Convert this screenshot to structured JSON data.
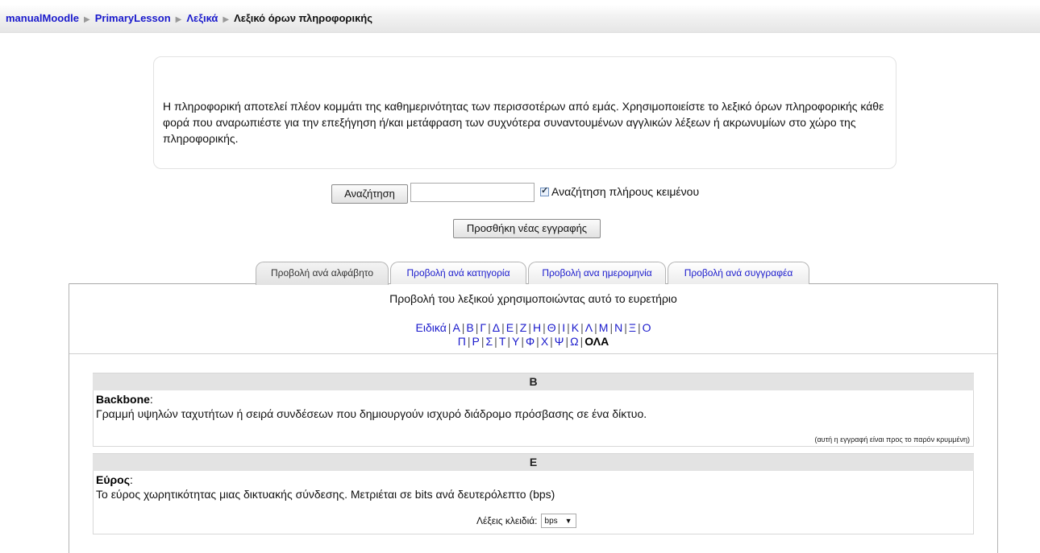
{
  "breadcrumb": {
    "items": [
      "manualMoodle",
      "PrimaryLesson",
      "Λεξικά"
    ],
    "current": "Λεξικό όρων πληροφορικής"
  },
  "intro": {
    "text": "Η πληροφορική αποτελεί πλέον κομμάτι της καθημερινότητας των περισσοτέρων από εμάς. Χρησιμοποιείστε το λεξικό όρων πληροφορικής κάθε φορά που αναρωπιέστε για την επεξήγηση ή/και μετάφραση των συχνότερα συναντουμένων αγγλικών λέξεων ή ακρωνυμίων στο χώρο της πληροφορικής."
  },
  "search": {
    "button_label": "Αναζήτηση",
    "input_value": "",
    "fulltext_checked": true,
    "fulltext_label": "Αναζήτηση πλήρους κειμένου"
  },
  "add_entry_label": "Προσθήκη νέας εγγραφής",
  "tabs": [
    {
      "label": "Προβολή ανά αλφάβητο",
      "active": true
    },
    {
      "label": "Προβολή ανά κατηγορία",
      "active": false
    },
    {
      "label": "Προβολή ανα ημερομηνία",
      "active": false
    },
    {
      "label": "Προβολή ανά συγγραφέα",
      "active": false
    }
  ],
  "index": {
    "title": "Προβολή του λεξικού χρησιμοποιώντας αυτό το ευρετήριο",
    "row1": [
      "Ειδικά",
      "Α",
      "Β",
      "Γ",
      "Δ",
      "Ε",
      "Ζ",
      "Η",
      "Θ",
      "Ι",
      "Κ",
      "Λ",
      "Μ",
      "Ν",
      "Ξ",
      "Ο"
    ],
    "row2": [
      "Π",
      "Ρ",
      "Σ",
      "Τ",
      "Υ",
      "Φ",
      "Χ",
      "Ψ",
      "Ω"
    ],
    "all_label": "ΟΛΑ"
  },
  "entries": [
    {
      "letter": "B",
      "term": "Backbone",
      "colon": ":",
      "definition": "Γραμμή υψηλών ταχυτήτων ή σειρά συνδέσεων που δημιουργούν ισχυρό διάδρομο πρόσβασης σε ένα δίκτυο.",
      "note": "(αυτή η εγγραφή είναι προς το παρόν κρυμμένη)"
    },
    {
      "letter": "E",
      "term": "Εύρος",
      "colon": ":",
      "definition": "Το εύρος χωρητικότητας μιας δικτυακής σύνδεσης. Μετριέται σε bits ανά δευτερόλεπτο (bps)",
      "keywords_label": "Λέξεις κλειδιά:",
      "keyword_selected": "bps"
    }
  ]
}
